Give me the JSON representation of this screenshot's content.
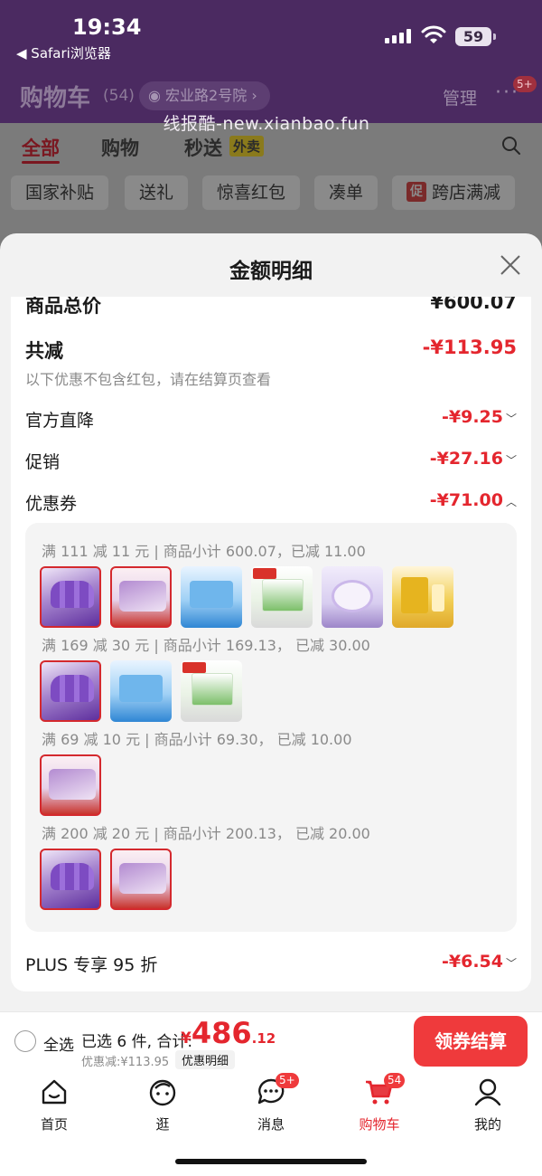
{
  "status_bar": {
    "time": "19:34",
    "back_app": "◀ Safari浏览器",
    "battery": "59"
  },
  "header": {
    "title": "购物车",
    "count": "(54)",
    "address": "宏业路2号院",
    "manage": "管理",
    "more_badge": "5+",
    "watermark": "线报酷-new.xianbao.fun"
  },
  "tabs": [
    {
      "label": "全部",
      "active": true
    },
    {
      "label": "购物",
      "active": false
    },
    {
      "label": "秒送",
      "active": false
    }
  ],
  "takeout_tag": "外卖",
  "chips": [
    "国家补贴",
    "送礼",
    "惊喜红包",
    "凑单",
    "跨店满减"
  ],
  "chip_promo_icon": "促",
  "sheet": {
    "title": "金额明细",
    "goods_total_label": "商品总价",
    "goods_total_value": "¥600.07",
    "total_discount_label": "共减",
    "total_discount_value": "-¥113.95",
    "hint": "以下优惠不包含红包，请在结算页查看",
    "rows": [
      {
        "label": "官方直降",
        "value": "-¥9.25"
      },
      {
        "label": "促销",
        "value": "-¥27.16"
      },
      {
        "label": "优惠券",
        "value": "-¥71.00"
      }
    ],
    "coupon_groups": [
      {
        "condition": "满 111 减 11 元 | 商品小计 600.07，已减 11.00",
        "items": [
          "purple",
          "wipe",
          "blue",
          "green",
          "lilac",
          "gold"
        ]
      },
      {
        "condition": "满 169 减 30 元 | 商品小计 169.13， 已减 30.00",
        "items": [
          "purple",
          "blue",
          "green"
        ]
      },
      {
        "condition": "满 69 减 10 元 | 商品小计 69.30， 已减 10.00",
        "items": [
          "wipe"
        ]
      },
      {
        "condition": "满 200 减 20 元 | 商品小计 200.13， 已减 20.00",
        "items": [
          "purple",
          "wipe"
        ]
      }
    ],
    "plus_label": "PLUS 专享 95 折",
    "plus_value": "-¥6.54"
  },
  "checkout": {
    "select_all": "全选",
    "selected": "已选 6 件, 合计:",
    "currency": "¥",
    "total_int": "486",
    "total_dec": ".12",
    "saved": "优惠减:¥113.95",
    "detail_link": "优惠明细",
    "button": "领券结算"
  },
  "tabbar": [
    {
      "label": "首页",
      "icon": "home-icon",
      "badge": ""
    },
    {
      "label": "逛",
      "icon": "stroll-face-icon",
      "badge": ""
    },
    {
      "label": "消息",
      "icon": "message-icon",
      "badge": "5+"
    },
    {
      "label": "购物车",
      "icon": "cart-icon",
      "badge": "54",
      "active": true
    },
    {
      "label": "我的",
      "icon": "profile-icon",
      "badge": ""
    }
  ],
  "colors": {
    "accent": "#e4262e",
    "button": "#ef3a3c",
    "header_bg": "#4b2a61"
  }
}
